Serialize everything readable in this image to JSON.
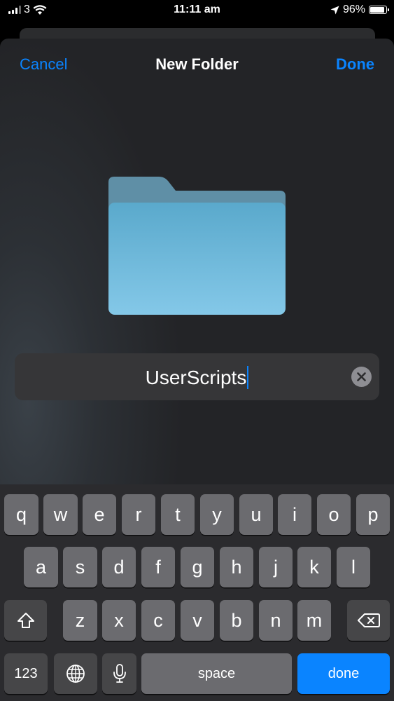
{
  "status": {
    "carrier": "3",
    "time": "11:11 am",
    "battery": "96%"
  },
  "nav": {
    "cancel": "Cancel",
    "title": "New Folder",
    "done": "Done"
  },
  "field": {
    "value": "UserScripts"
  },
  "keyboard": {
    "row1": [
      "q",
      "w",
      "e",
      "r",
      "t",
      "y",
      "u",
      "i",
      "o",
      "p"
    ],
    "row2": [
      "a",
      "s",
      "d",
      "f",
      "g",
      "h",
      "j",
      "k",
      "l"
    ],
    "row3": [
      "z",
      "x",
      "c",
      "v",
      "b",
      "n",
      "m"
    ],
    "numbers": "123",
    "space": "space",
    "done": "done"
  },
  "colors": {
    "accent": "#0a84ff",
    "folder": "#6bb8db"
  }
}
